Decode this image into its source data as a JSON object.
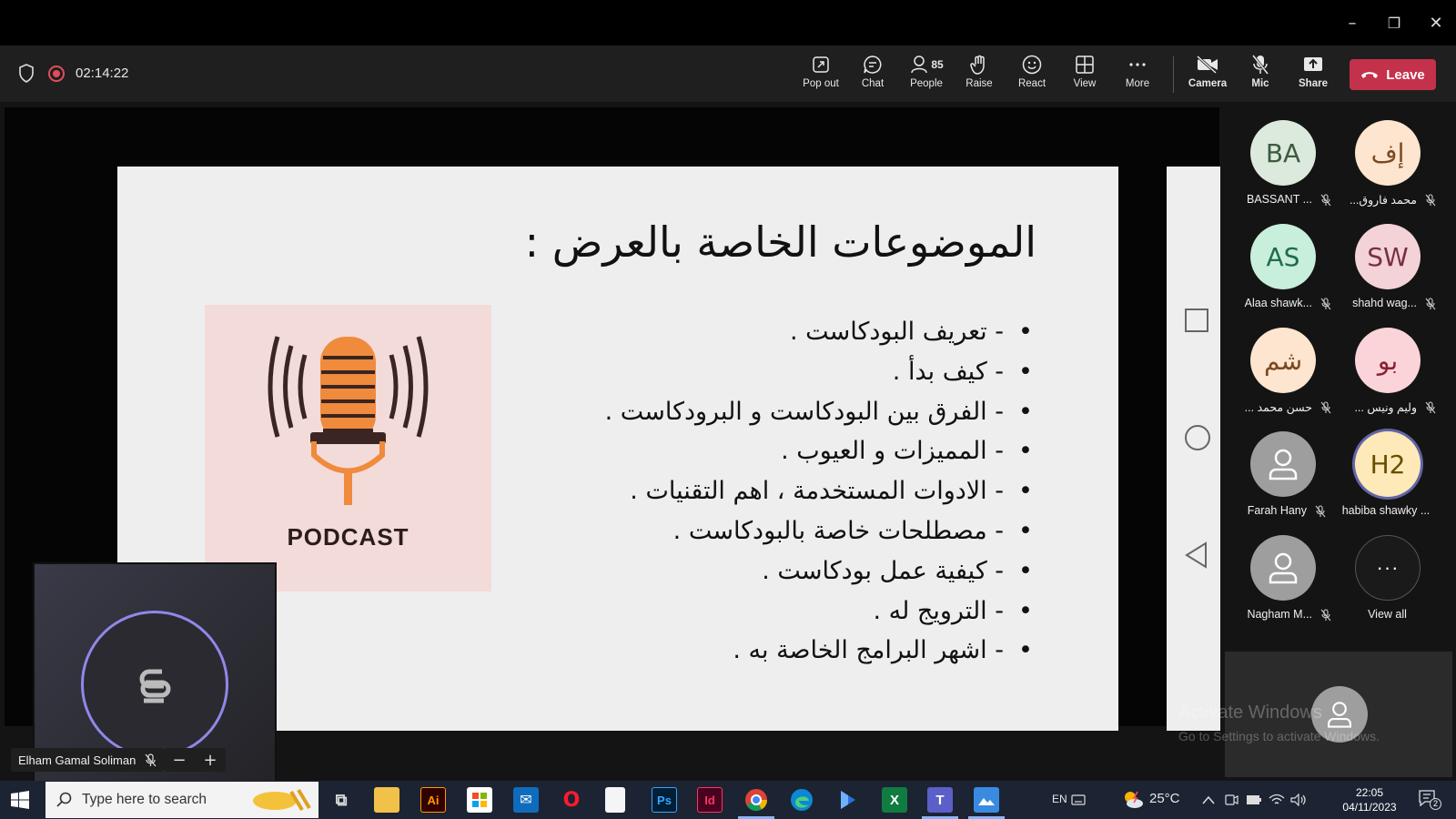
{
  "window_controls": {
    "minimize": "–",
    "restore": "❐",
    "close": "✕"
  },
  "meeting": {
    "timer": "02:14:22"
  },
  "toolbar": {
    "buttons": [
      {
        "label": "Pop out",
        "icon": "pop-out-icon"
      },
      {
        "label": "Chat",
        "icon": "chat-icon"
      },
      {
        "label": "People",
        "icon": "people-icon",
        "count": "85"
      },
      {
        "label": "Raise",
        "icon": "raise-hand-icon"
      },
      {
        "label": "React",
        "icon": "react-icon"
      },
      {
        "label": "View",
        "icon": "view-icon"
      },
      {
        "label": "More",
        "icon": "more-icon"
      },
      {
        "label": "Camera",
        "icon": "camera-off-icon"
      },
      {
        "label": "Mic",
        "icon": "mic-off-icon"
      },
      {
        "label": "Share",
        "icon": "share-icon"
      }
    ],
    "leave_label": "Leave",
    "leave_color": "#c4314b"
  },
  "slide": {
    "title": "الموضوعات الخاصة بالعرض :",
    "bullets": [
      "- تعريف البودكاست .",
      "- كيف بدأ .",
      "- الفرق بين البودكاست و البرودكاست .",
      "- المميزات و العيوب .",
      "- الادوات المستخدمة ، اهم التقنيات .",
      "- مصطلحات خاصة بالبودكاست .",
      "- كيفية عمل بودكاست .",
      "- الترويج له .",
      "- اشهر البرامج الخاصة به ."
    ],
    "image_caption": "PODCAST"
  },
  "presenter": {
    "name": "Elham Gamal Soliman",
    "zoom_out": "−",
    "zoom_in": "+"
  },
  "participants": [
    {
      "initials": "BA",
      "name": "BASSANT ...",
      "bg": "#dbeadc",
      "fg": "#3d5a3f"
    },
    {
      "initials": "إف",
      "name": "...محمد فاروق",
      "bg": "#fde5cf",
      "fg": "#7a4a1f"
    },
    {
      "initials": "AS",
      "name": "Alaa shawk...",
      "bg": "#c8eedc",
      "fg": "#1f6b4a"
    },
    {
      "initials": "SW",
      "name": "shahd wag...",
      "bg": "#f3d3d8",
      "fg": "#7a3040"
    },
    {
      "initials": "شم",
      "name": "... حسن محمد",
      "bg": "#fde5cf",
      "fg": "#7a4a1f"
    },
    {
      "initials": "بو",
      "name": "... وليم ونيس",
      "bg": "#fad4d8",
      "fg": "#8a2030"
    },
    {
      "initials": "",
      "name": "Farah Hany",
      "generic": true
    },
    {
      "initials": "H2",
      "name": "habiba shawky ...",
      "bg": "#fdeab8",
      "fg": "#6b4c00"
    },
    {
      "initials": "",
      "name": "Nagham M...",
      "generic": true
    }
  ],
  "view_all": {
    "icon": "···",
    "label": "View all"
  },
  "watermark": {
    "line1": "Activate Windows",
    "line2": "Go to Settings to activate Windows."
  },
  "taskbar": {
    "search_placeholder": "Type here to search",
    "apps": [
      {
        "name": "task-view",
        "text": "⧉"
      },
      {
        "name": "file-explorer",
        "text": ""
      },
      {
        "name": "illustrator",
        "text": "Ai"
      },
      {
        "name": "ms-store",
        "text": ""
      },
      {
        "name": "mail",
        "text": "✉"
      },
      {
        "name": "opera",
        "text": "O"
      },
      {
        "name": "notepad",
        "text": ""
      },
      {
        "name": "photoshop",
        "text": "Ps"
      },
      {
        "name": "indesign",
        "text": "Id"
      },
      {
        "name": "chrome",
        "text": ""
      },
      {
        "name": "edge",
        "text": ""
      },
      {
        "name": "power-automate",
        "text": ""
      },
      {
        "name": "excel",
        "text": "X"
      },
      {
        "name": "teams",
        "text": "T"
      },
      {
        "name": "photos",
        "text": ""
      }
    ],
    "language": "EN",
    "weather": "25°C",
    "time": "22:05",
    "date": "04/11/2023",
    "notifications": "2"
  }
}
